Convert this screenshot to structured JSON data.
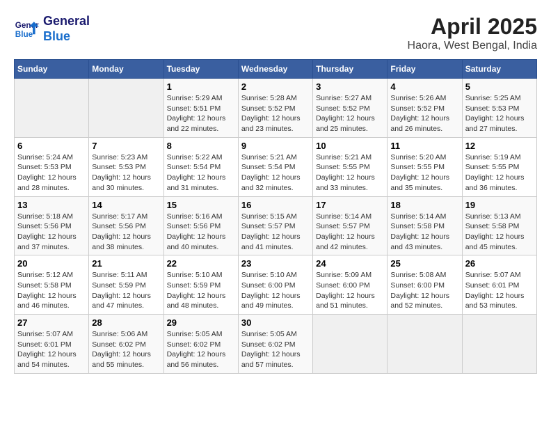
{
  "header": {
    "logo": {
      "line1": "General",
      "line2": "Blue"
    },
    "title": "April 2025",
    "subtitle": "Haora, West Bengal, India"
  },
  "weekdays": [
    "Sunday",
    "Monday",
    "Tuesday",
    "Wednesday",
    "Thursday",
    "Friday",
    "Saturday"
  ],
  "weeks": [
    [
      {
        "day": "",
        "info": ""
      },
      {
        "day": "",
        "info": ""
      },
      {
        "day": "1",
        "info": "Sunrise: 5:29 AM\nSunset: 5:51 PM\nDaylight: 12 hours\nand 22 minutes."
      },
      {
        "day": "2",
        "info": "Sunrise: 5:28 AM\nSunset: 5:52 PM\nDaylight: 12 hours\nand 23 minutes."
      },
      {
        "day": "3",
        "info": "Sunrise: 5:27 AM\nSunset: 5:52 PM\nDaylight: 12 hours\nand 25 minutes."
      },
      {
        "day": "4",
        "info": "Sunrise: 5:26 AM\nSunset: 5:52 PM\nDaylight: 12 hours\nand 26 minutes."
      },
      {
        "day": "5",
        "info": "Sunrise: 5:25 AM\nSunset: 5:53 PM\nDaylight: 12 hours\nand 27 minutes."
      }
    ],
    [
      {
        "day": "6",
        "info": "Sunrise: 5:24 AM\nSunset: 5:53 PM\nDaylight: 12 hours\nand 28 minutes."
      },
      {
        "day": "7",
        "info": "Sunrise: 5:23 AM\nSunset: 5:53 PM\nDaylight: 12 hours\nand 30 minutes."
      },
      {
        "day": "8",
        "info": "Sunrise: 5:22 AM\nSunset: 5:54 PM\nDaylight: 12 hours\nand 31 minutes."
      },
      {
        "day": "9",
        "info": "Sunrise: 5:21 AM\nSunset: 5:54 PM\nDaylight: 12 hours\nand 32 minutes."
      },
      {
        "day": "10",
        "info": "Sunrise: 5:21 AM\nSunset: 5:55 PM\nDaylight: 12 hours\nand 33 minutes."
      },
      {
        "day": "11",
        "info": "Sunrise: 5:20 AM\nSunset: 5:55 PM\nDaylight: 12 hours\nand 35 minutes."
      },
      {
        "day": "12",
        "info": "Sunrise: 5:19 AM\nSunset: 5:55 PM\nDaylight: 12 hours\nand 36 minutes."
      }
    ],
    [
      {
        "day": "13",
        "info": "Sunrise: 5:18 AM\nSunset: 5:56 PM\nDaylight: 12 hours\nand 37 minutes."
      },
      {
        "day": "14",
        "info": "Sunrise: 5:17 AM\nSunset: 5:56 PM\nDaylight: 12 hours\nand 38 minutes."
      },
      {
        "day": "15",
        "info": "Sunrise: 5:16 AM\nSunset: 5:56 PM\nDaylight: 12 hours\nand 40 minutes."
      },
      {
        "day": "16",
        "info": "Sunrise: 5:15 AM\nSunset: 5:57 PM\nDaylight: 12 hours\nand 41 minutes."
      },
      {
        "day": "17",
        "info": "Sunrise: 5:14 AM\nSunset: 5:57 PM\nDaylight: 12 hours\nand 42 minutes."
      },
      {
        "day": "18",
        "info": "Sunrise: 5:14 AM\nSunset: 5:58 PM\nDaylight: 12 hours\nand 43 minutes."
      },
      {
        "day": "19",
        "info": "Sunrise: 5:13 AM\nSunset: 5:58 PM\nDaylight: 12 hours\nand 45 minutes."
      }
    ],
    [
      {
        "day": "20",
        "info": "Sunrise: 5:12 AM\nSunset: 5:58 PM\nDaylight: 12 hours\nand 46 minutes."
      },
      {
        "day": "21",
        "info": "Sunrise: 5:11 AM\nSunset: 5:59 PM\nDaylight: 12 hours\nand 47 minutes."
      },
      {
        "day": "22",
        "info": "Sunrise: 5:10 AM\nSunset: 5:59 PM\nDaylight: 12 hours\nand 48 minutes."
      },
      {
        "day": "23",
        "info": "Sunrise: 5:10 AM\nSunset: 6:00 PM\nDaylight: 12 hours\nand 49 minutes."
      },
      {
        "day": "24",
        "info": "Sunrise: 5:09 AM\nSunset: 6:00 PM\nDaylight: 12 hours\nand 51 minutes."
      },
      {
        "day": "25",
        "info": "Sunrise: 5:08 AM\nSunset: 6:00 PM\nDaylight: 12 hours\nand 52 minutes."
      },
      {
        "day": "26",
        "info": "Sunrise: 5:07 AM\nSunset: 6:01 PM\nDaylight: 12 hours\nand 53 minutes."
      }
    ],
    [
      {
        "day": "27",
        "info": "Sunrise: 5:07 AM\nSunset: 6:01 PM\nDaylight: 12 hours\nand 54 minutes."
      },
      {
        "day": "28",
        "info": "Sunrise: 5:06 AM\nSunset: 6:02 PM\nDaylight: 12 hours\nand 55 minutes."
      },
      {
        "day": "29",
        "info": "Sunrise: 5:05 AM\nSunset: 6:02 PM\nDaylight: 12 hours\nand 56 minutes."
      },
      {
        "day": "30",
        "info": "Sunrise: 5:05 AM\nSunset: 6:02 PM\nDaylight: 12 hours\nand 57 minutes."
      },
      {
        "day": "",
        "info": ""
      },
      {
        "day": "",
        "info": ""
      },
      {
        "day": "",
        "info": ""
      }
    ]
  ]
}
